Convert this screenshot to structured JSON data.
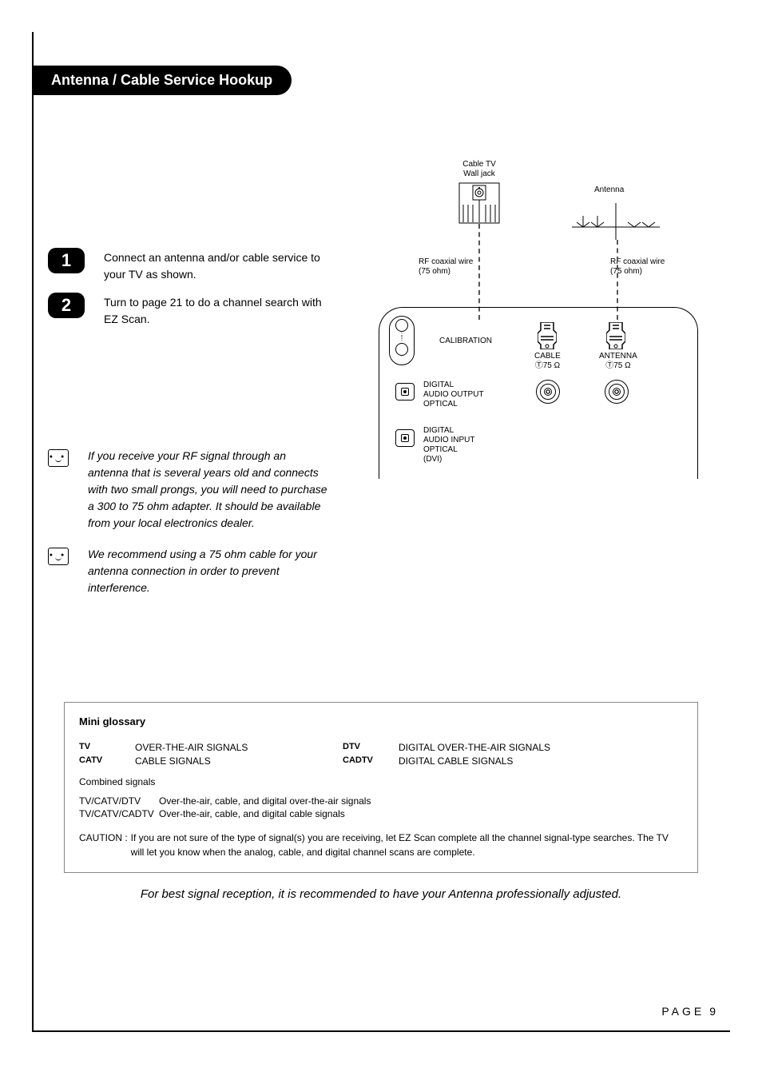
{
  "section_title": "Antenna / Cable Service Hookup",
  "steps": [
    {
      "num": "1",
      "text": "Connect an antenna and/or cable service to your TV as shown."
    },
    {
      "num": "2",
      "text": "Turn to page 21 to do a channel search with EZ Scan."
    }
  ],
  "notes": [
    {
      "text": "If you receive your RF signal through an antenna that is several years old and connects with two small prongs, you will need to purchase a 300 to 75 ohm adapter. It should be available from your local electronics dealer."
    },
    {
      "text": "We recommend using a 75 ohm cable for your antenna connection in order to prevent interference."
    }
  ],
  "diagram": {
    "wall_jack": "Cable TV\nWall jack",
    "antenna": "Antenna",
    "coax1": "RF coaxial wire\n(75 ohm)",
    "coax2": "RF coaxial wire\n(75 ohm)",
    "panel": {
      "calibration": "CALIBRATION",
      "cable": "CABLE",
      "cable_ohm": "Ⓣ75 Ω",
      "antenna": "ANTENNA",
      "antenna_ohm": "Ⓣ75 Ω",
      "digital_audio_output": "DIGITAL\nAUDIO OUTPUT\nOPTICAL",
      "digital_audio_input": "DIGITAL\nAUDIO INPUT\nOPTICAL\n(DVI)"
    }
  },
  "glossary": {
    "title": "Mini glossary",
    "entries": [
      {
        "term": "TV",
        "def": "OVER-THE-AIR SIGNALS"
      },
      {
        "term": "DTV",
        "def": "DIGITAL OVER-THE-AIR SIGNALS"
      },
      {
        "term": "CATV",
        "def": "CABLE SIGNALS"
      },
      {
        "term": "CADTV",
        "def": "DIGITAL CABLE SIGNALS"
      }
    ],
    "combined_title": "Combined signals",
    "combined": [
      {
        "term": "TV/CATV/DTV",
        "def": "Over-the-air, cable, and digital over-the-air signals"
      },
      {
        "term": "TV/CATV/CADTV",
        "def": "Over-the-air, cable, and digital cable signals"
      }
    ],
    "caution_label": "CAUTION :",
    "caution_text": "If you are not sure of the type of signal(s) you are receiving, let EZ Scan complete all the channel signal-type searches. The TV will let you know when the analog, cable, and digital channel scans are complete."
  },
  "recommendation": "For best signal reception, it is recommended to have your Antenna professionally adjusted.",
  "page_label": "PAGE",
  "page_number": "9"
}
